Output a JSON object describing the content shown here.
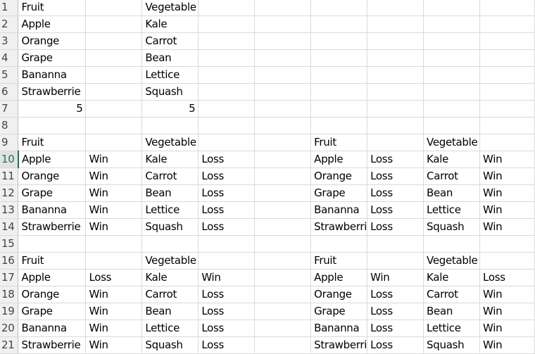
{
  "sheet": {
    "selected_row": 10,
    "rows": [
      {
        "n": "1",
        "cells": [
          "Fruit",
          "",
          "Vegetable",
          "",
          "",
          "",
          "",
          "",
          ""
        ]
      },
      {
        "n": "2",
        "cells": [
          "Apple",
          "",
          "Kale",
          "",
          "",
          "",
          "",
          "",
          ""
        ]
      },
      {
        "n": "3",
        "cells": [
          "Orange",
          "",
          "Carrot",
          "",
          "",
          "",
          "",
          "",
          ""
        ]
      },
      {
        "n": "4",
        "cells": [
          "Grape",
          "",
          "Bean",
          "",
          "",
          "",
          "",
          "",
          ""
        ]
      },
      {
        "n": "5",
        "cells": [
          "Bananna",
          "",
          "Lettice",
          "",
          "",
          "",
          "",
          "",
          ""
        ]
      },
      {
        "n": "6",
        "cells": [
          "Strawberrie",
          "",
          "Squash",
          "",
          "",
          "",
          "",
          "",
          ""
        ]
      },
      {
        "n": "7",
        "cells": [
          "5",
          "",
          "5",
          "",
          "",
          "",
          "",
          "",
          ""
        ]
      },
      {
        "n": "8",
        "cells": [
          "",
          "",
          "",
          "",
          "",
          "",
          "",
          "",
          ""
        ]
      },
      {
        "n": "9",
        "cells": [
          "Fruit",
          "",
          "Vegetable",
          "",
          "",
          "Fruit",
          "",
          "Vegetable",
          ""
        ]
      },
      {
        "n": "10",
        "cells": [
          "Apple",
          "Win",
          "Kale",
          "Loss",
          "",
          "Apple",
          "Loss",
          "Kale",
          "Win"
        ]
      },
      {
        "n": "11",
        "cells": [
          "Orange",
          "Win",
          "Carrot",
          "Loss",
          "",
          "Orange",
          "Loss",
          "Carrot",
          "Win"
        ]
      },
      {
        "n": "12",
        "cells": [
          "Grape",
          "Win",
          "Bean",
          "Loss",
          "",
          "Grape",
          "Loss",
          "Bean",
          "Win"
        ]
      },
      {
        "n": "13",
        "cells": [
          "Bananna",
          "Win",
          "Lettice",
          "Loss",
          "",
          "Bananna",
          "Loss",
          "Lettice",
          "Win"
        ]
      },
      {
        "n": "14",
        "cells": [
          "Strawberrie",
          "Win",
          "Squash",
          "Loss",
          "",
          "Strawberri",
          "Loss",
          "Squash",
          "Win"
        ]
      },
      {
        "n": "15",
        "cells": [
          "",
          "",
          "",
          "",
          "",
          "",
          "",
          "",
          ""
        ]
      },
      {
        "n": "16",
        "cells": [
          "Fruit",
          "",
          "Vegetable",
          "",
          "",
          "Fruit",
          "",
          "Vegetable",
          ""
        ]
      },
      {
        "n": "17",
        "cells": [
          "Apple",
          "Loss",
          "Kale",
          "Win",
          "",
          "Apple",
          "Win",
          "Kale",
          "Loss"
        ]
      },
      {
        "n": "18",
        "cells": [
          "Orange",
          "Win",
          "Carrot",
          "Loss",
          "",
          "Orange",
          "Loss",
          "Carrot",
          "Win"
        ]
      },
      {
        "n": "19",
        "cells": [
          "Grape",
          "Win",
          "Bean",
          "Loss",
          "",
          "Grape",
          "Loss",
          "Bean",
          "Win"
        ]
      },
      {
        "n": "20",
        "cells": [
          "Bananna",
          "Win",
          "Lettice",
          "Loss",
          "",
          "Bananna",
          "Loss",
          "Lettice",
          "Win"
        ]
      },
      {
        "n": "21",
        "cells": [
          "Strawberrie",
          "Win",
          "Squash",
          "Loss",
          "",
          "Strawberri",
          "Loss",
          "Squash",
          "Win"
        ]
      }
    ],
    "numeric_cells": [
      [
        7,
        0
      ],
      [
        7,
        2
      ]
    ],
    "colors": {
      "selection": "#217346",
      "gridline": "#dadada",
      "header_bg": "#f0f0f0"
    }
  }
}
